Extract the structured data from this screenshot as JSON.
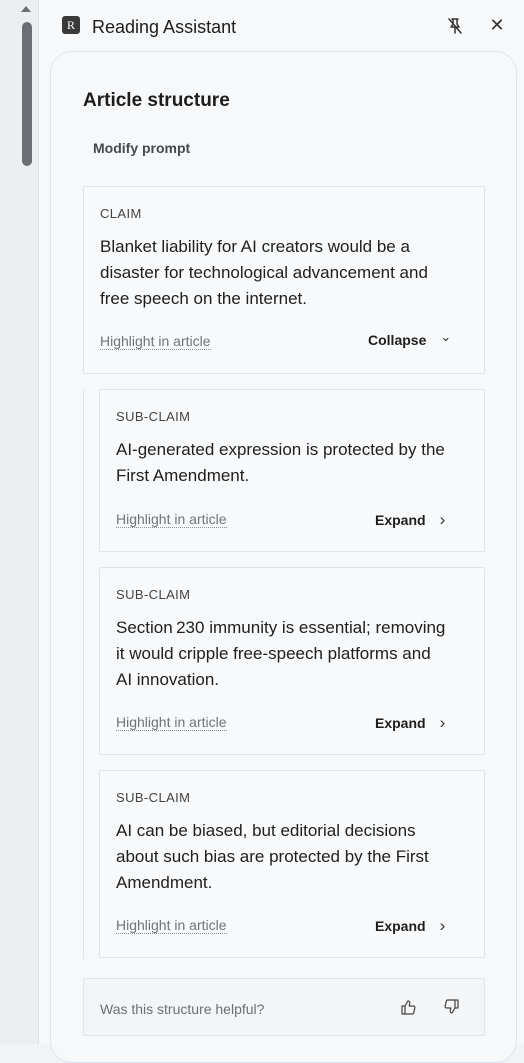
{
  "header": {
    "logo_letter": "R",
    "title": "Reading Assistant",
    "pin_icon": "unpin-icon",
    "close_icon": "close-icon",
    "close_glyph": "✕"
  },
  "main": {
    "section_title": "Article structure",
    "modify_prompt": "Modify prompt",
    "claim": {
      "label": "CLAIM",
      "lines": [
        "Blanket liability for AI creators would be a",
        "disaster for technological advancement and",
        "free speech on the internet."
      ],
      "highlight": "Highlight in article",
      "toggle": "Collapse",
      "toggle_icon": "chevron-down-icon",
      "toggle_glyph": "⌄"
    },
    "sub_claims": [
      {
        "label": "SUB-CLAIM",
        "lines": [
          "AI-generated expression is protected by the",
          "First Amendment."
        ],
        "highlight": "Highlight in article",
        "toggle": "Expand",
        "toggle_glyph": "›"
      },
      {
        "label": "SUB-CLAIM",
        "lines": [
          "Section 230 immunity is essential; removing",
          "it would cripple free-speech platforms and",
          "AI innovation."
        ],
        "highlight": "Highlight in article",
        "toggle": "Expand",
        "toggle_glyph": "›"
      },
      {
        "label": "SUB-CLAIM",
        "lines": [
          "AI can be biased, but editorial decisions",
          "about such bias are protected by the First",
          "Amendment."
        ],
        "highlight": "Highlight in article",
        "toggle": "Expand",
        "toggle_glyph": "›"
      }
    ],
    "feedback": {
      "question": "Was this structure helpful?",
      "thumbs_up_icon": "thumbs-up-icon",
      "thumbs_down_icon": "thumbs-down-icon"
    }
  },
  "colors": {
    "background": "#f6f8fa",
    "card_border": "#e1e5ea",
    "link": "#6e747a"
  }
}
